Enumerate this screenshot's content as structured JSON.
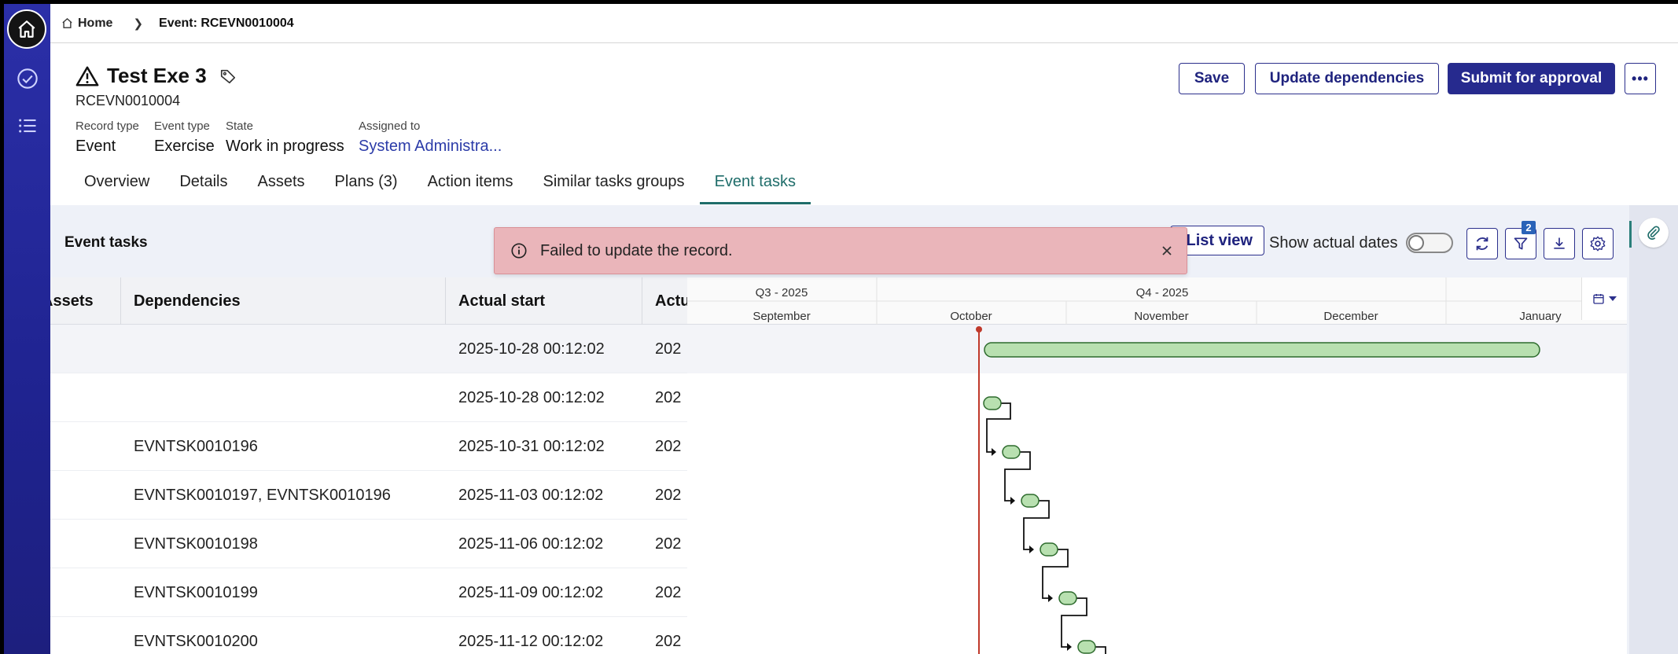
{
  "breadcrumb": {
    "home": "Home",
    "current": "Event: RCEVN0010004"
  },
  "record": {
    "title": "Test Exe 3",
    "number": "RCEVN0010004",
    "fields": [
      {
        "label": "Record type",
        "value": "Event"
      },
      {
        "label": "Event type",
        "value": "Exercise"
      },
      {
        "label": "State",
        "value": "Work in progress"
      },
      {
        "label": "Assigned to",
        "value": "System Administra..."
      }
    ]
  },
  "actions": {
    "save": "Save",
    "update_dependencies": "Update dependencies",
    "submit": "Submit for approval"
  },
  "tabs": [
    "Overview",
    "Details",
    "Assets",
    "Plans (3)",
    "Action items",
    "Similar tasks groups",
    "Event tasks"
  ],
  "active_tab": "Event tasks",
  "event_tasks": {
    "title": "Event tasks",
    "list_view": "List view",
    "show_actual_dates": "Show actual dates",
    "filter_count": "2",
    "columns": [
      "Assets",
      "Dependencies",
      "Actual start",
      "Actu"
    ],
    "rows": [
      {
        "dependencies": "",
        "actual_start": "2025-10-28 00:12:02",
        "actual_end": "202"
      },
      {
        "dependencies": "",
        "actual_start": "2025-10-28 00:12:02",
        "actual_end": "202"
      },
      {
        "dependencies": "EVNTSK0010196",
        "actual_start": "2025-10-31 00:12:02",
        "actual_end": "202"
      },
      {
        "dependencies": "EVNTSK0010197, EVNTSK0010196",
        "actual_start": "2025-11-03 00:12:02",
        "actual_end": "202"
      },
      {
        "dependencies": "EVNTSK0010198",
        "actual_start": "2025-11-06 00:12:02",
        "actual_end": "202"
      },
      {
        "dependencies": "EVNTSK0010199",
        "actual_start": "2025-11-09 00:12:02",
        "actual_end": "202"
      },
      {
        "dependencies": "EVNTSK0010200",
        "actual_start": "2025-11-12 00:12:02",
        "actual_end": "202"
      }
    ]
  },
  "gantt": {
    "quarters": [
      "Q3 - 2025",
      "Q4 - 2025"
    ],
    "months": [
      "September",
      "October",
      "November",
      "December",
      "January"
    ],
    "today_marker_color": "#c0392b",
    "bar_color": "#b8e0b0"
  },
  "toast": {
    "message": "Failed to update the record."
  }
}
